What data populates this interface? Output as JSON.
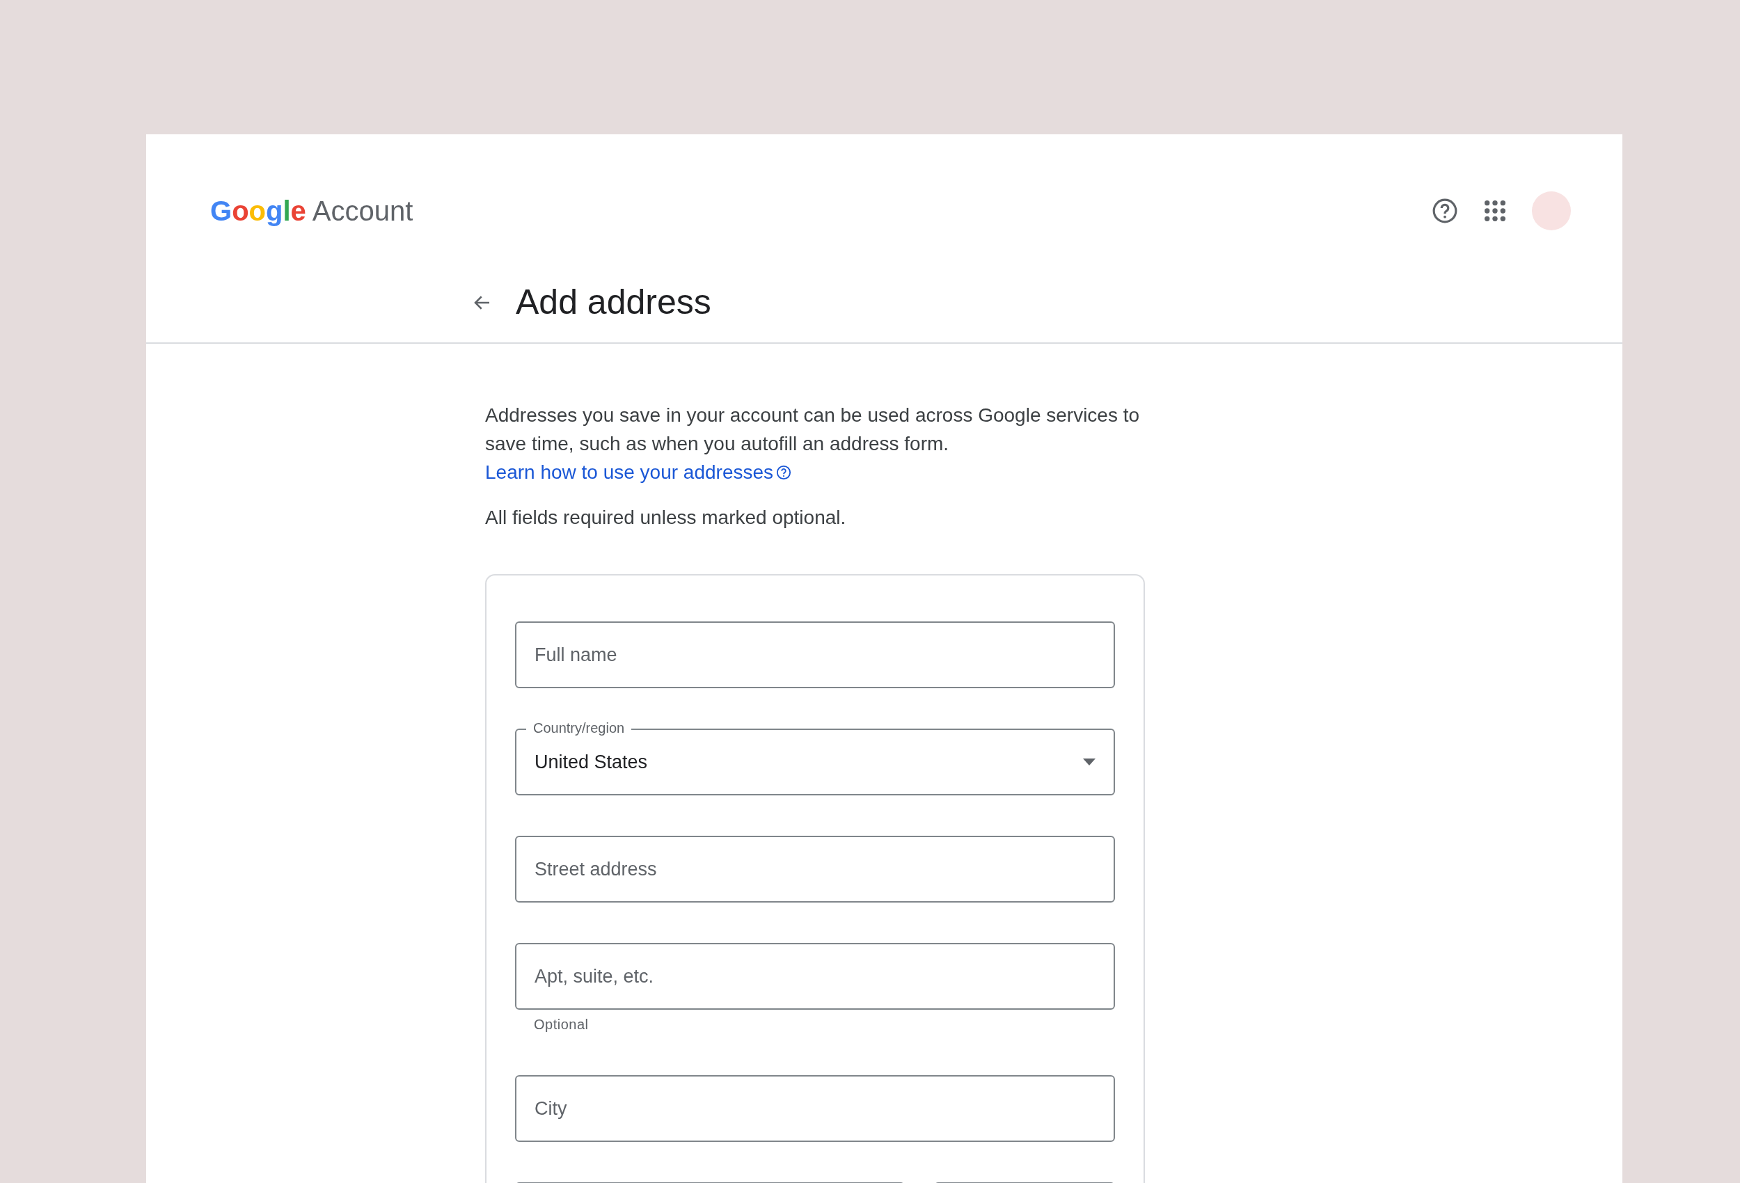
{
  "header": {
    "logo_letters": [
      {
        "text": "G",
        "color": "#4285f4"
      },
      {
        "text": "o",
        "color": "#ea4335"
      },
      {
        "text": "o",
        "color": "#fbbc05"
      },
      {
        "text": "g",
        "color": "#4285f4"
      },
      {
        "text": "l",
        "color": "#34a853"
      },
      {
        "text": "e",
        "color": "#ea4335"
      }
    ],
    "product": "Account"
  },
  "page": {
    "title": "Add address"
  },
  "intro": {
    "text": "Addresses you save in your account can be used across Google services to save time, such as when you autofill an address form.",
    "link": "Learn how to use your addresses"
  },
  "note": "All fields required unless marked optional.",
  "fields": [
    {
      "kind": "text",
      "placeholder": "Full name"
    },
    {
      "kind": "select",
      "label": "Country/region",
      "value": "United States"
    },
    {
      "kind": "text",
      "placeholder": "Street address"
    },
    {
      "kind": "text",
      "placeholder": "Apt, suite, etc.",
      "helper": "Optional"
    },
    {
      "kind": "text",
      "placeholder": "City"
    }
  ]
}
